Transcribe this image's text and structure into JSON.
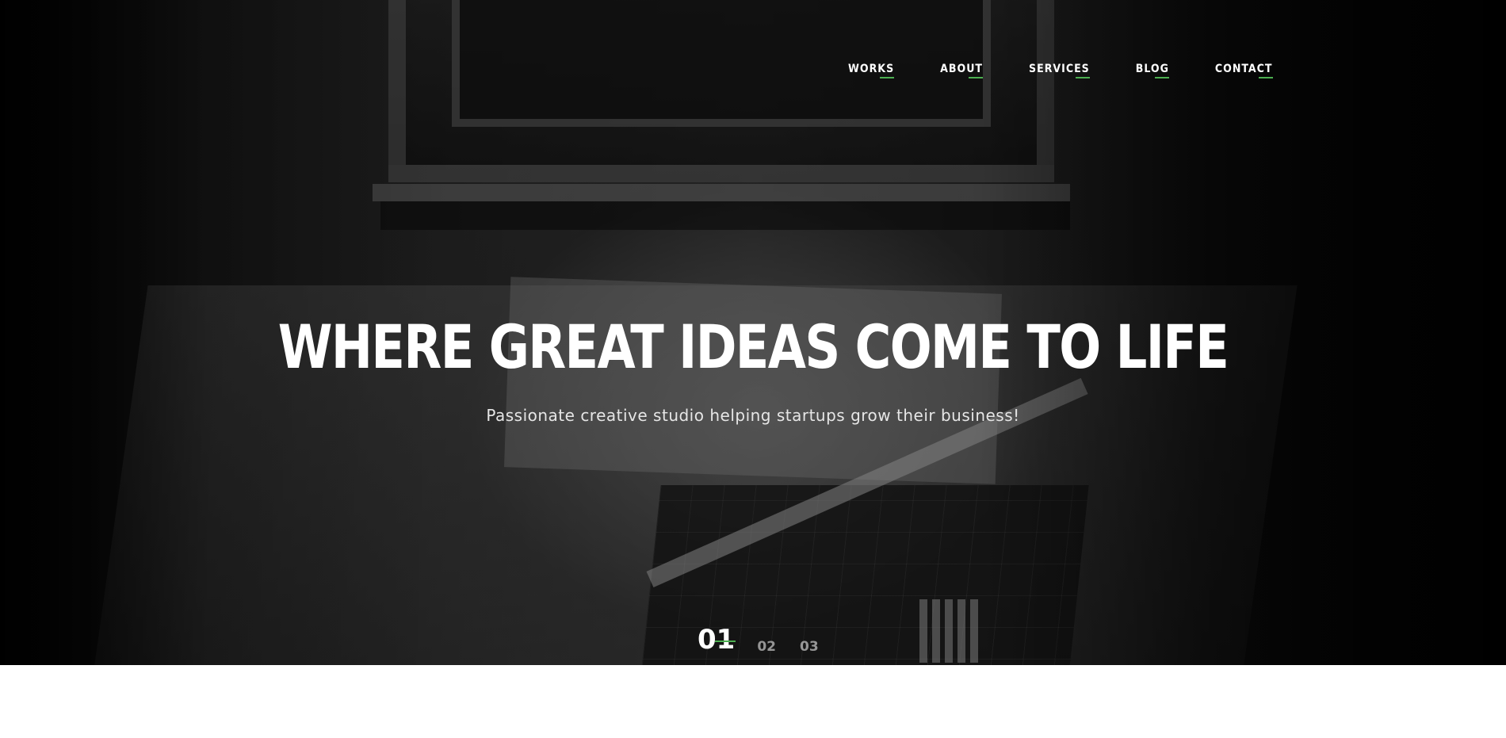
{
  "nav": {
    "items": [
      {
        "label": "WORKS"
      },
      {
        "label": "ABOUT"
      },
      {
        "label": "SERVICES"
      },
      {
        "label": "BLOG"
      },
      {
        "label": "CONTACT"
      }
    ]
  },
  "hero": {
    "title": "WHERE GREAT IDEAS COME TO LIFE",
    "subtitle": "Passionate creative studio helping startups grow their business!"
  },
  "slider": {
    "slides": [
      "01",
      "02",
      "03"
    ],
    "active_index": 0
  },
  "colors": {
    "accent": "#4caf50",
    "hero_text": "#ffffff",
    "page_background": "#ffffff"
  }
}
